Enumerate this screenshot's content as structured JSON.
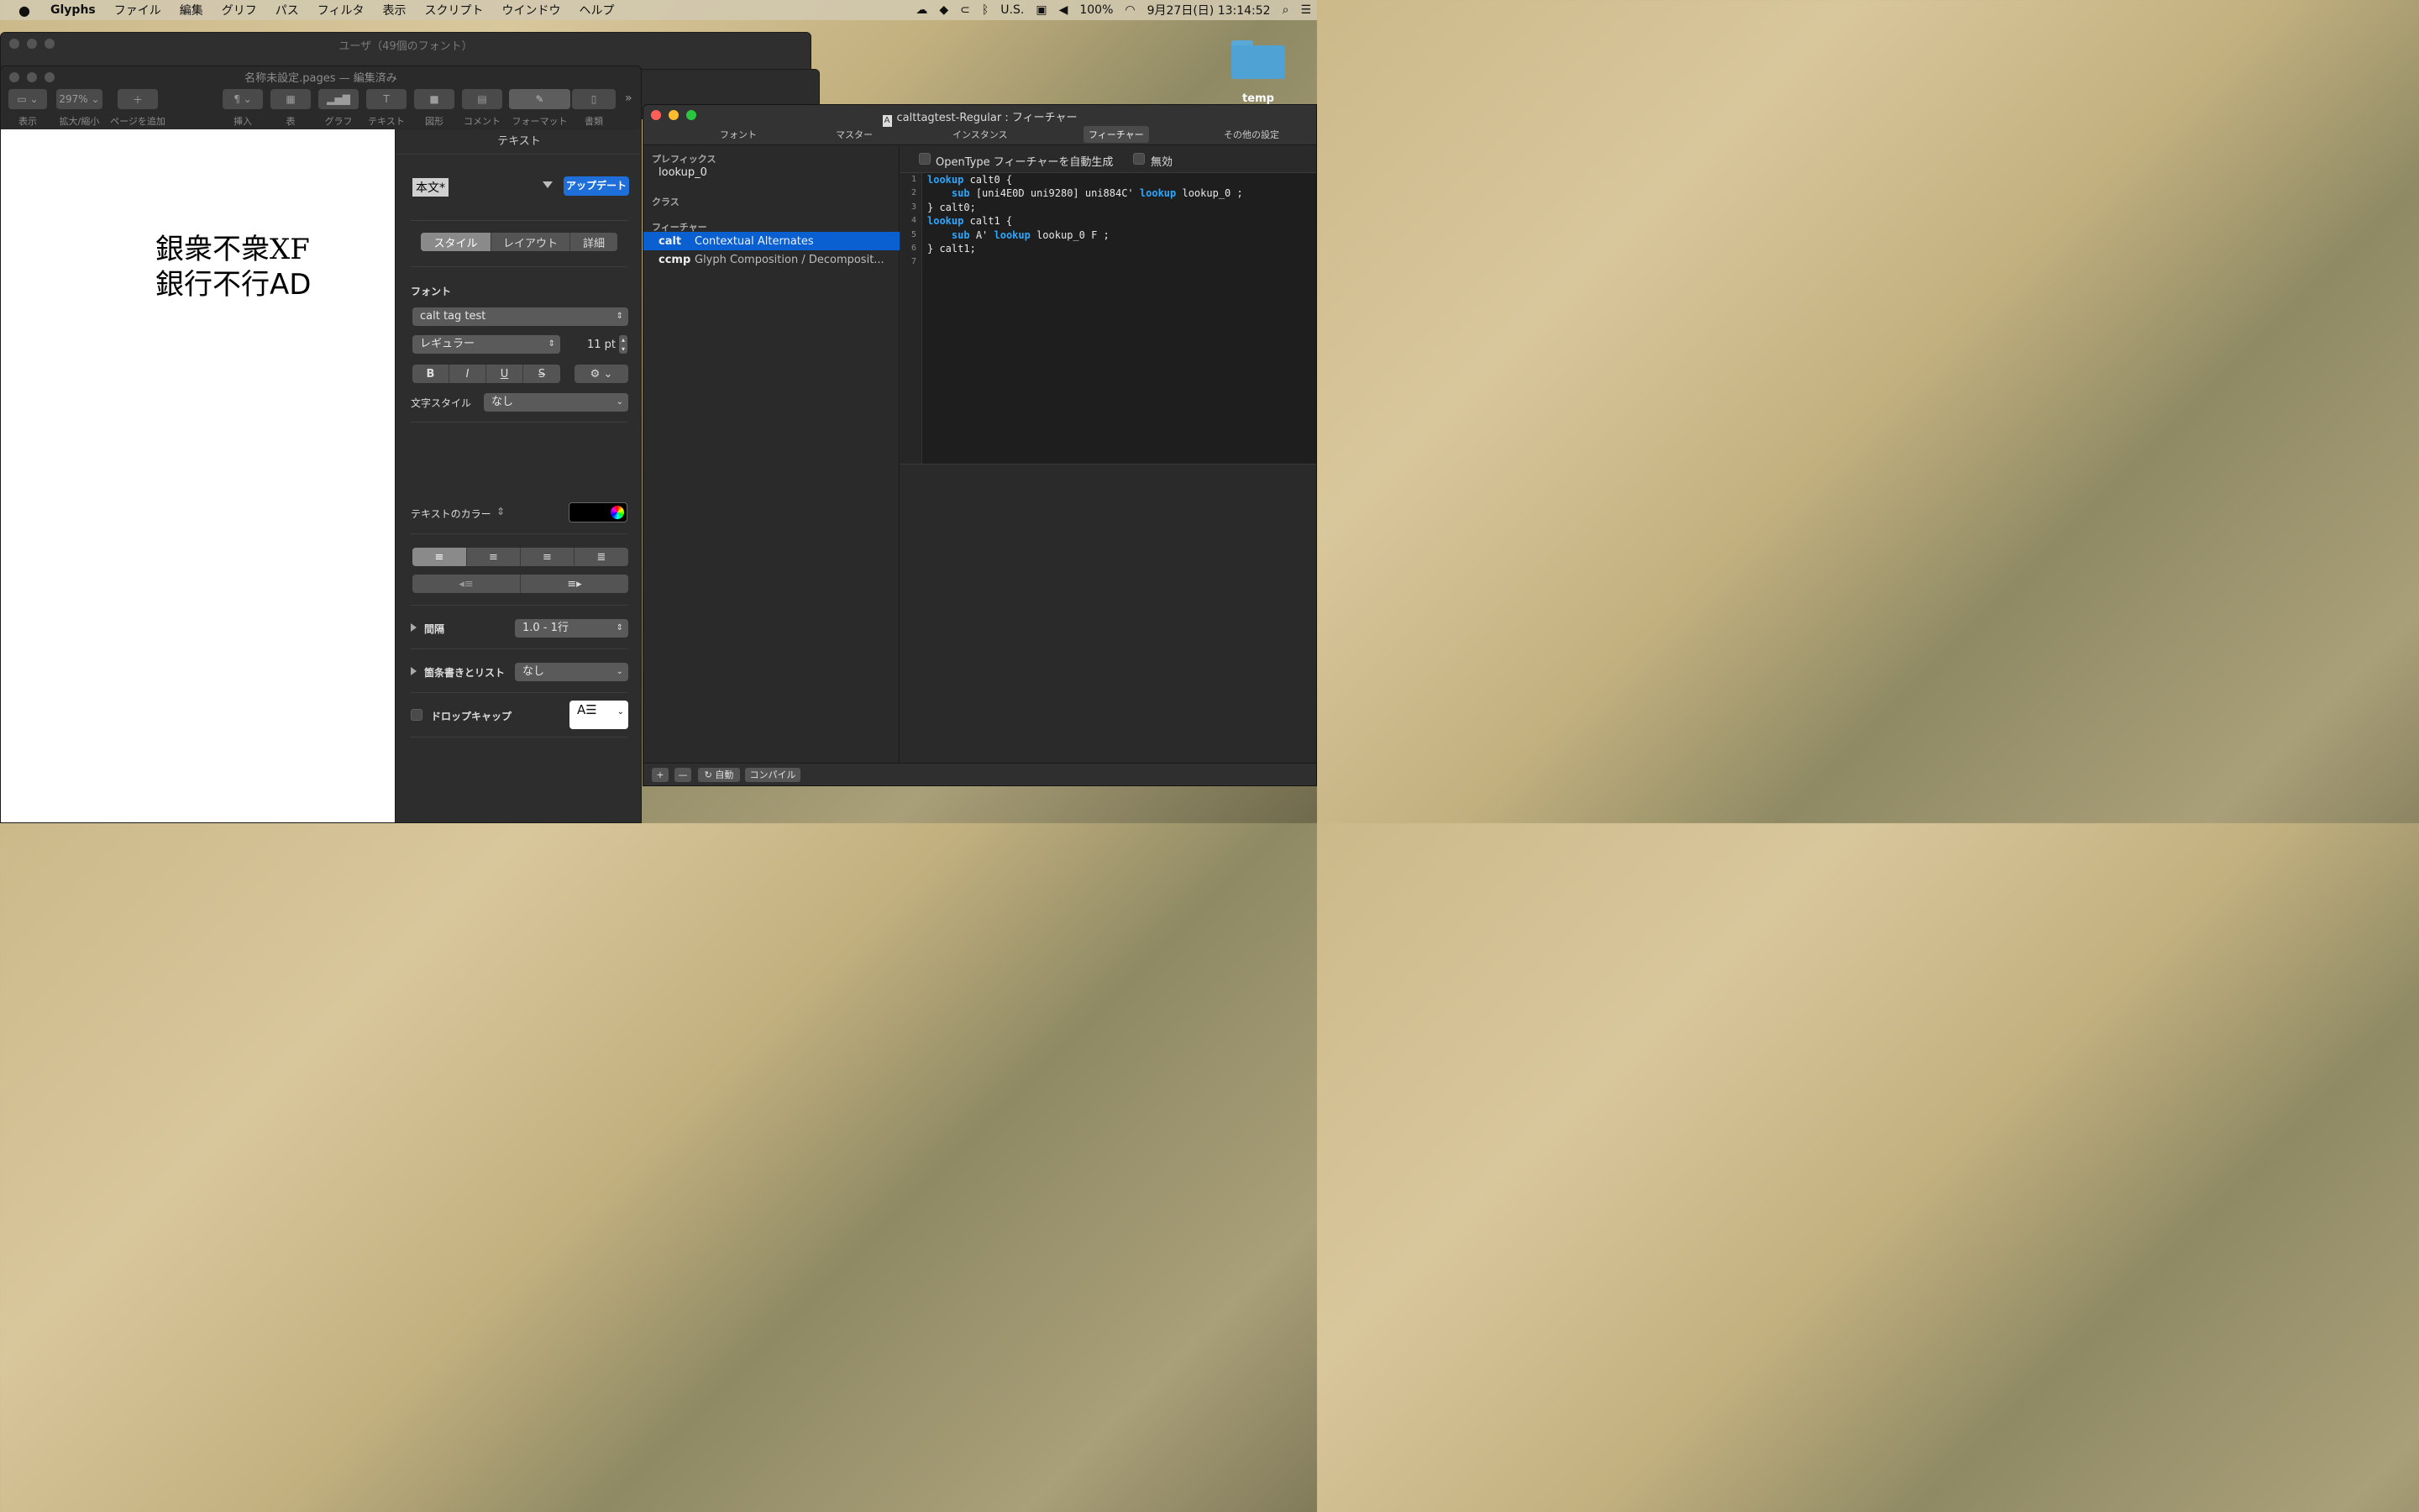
{
  "menubar": {
    "apple": "",
    "app": "Glyphs",
    "items": [
      "ファイル",
      "編集",
      "グリフ",
      "パス",
      "フィルタ",
      "表示",
      "スクリプト",
      "ウインドウ",
      "ヘルプ"
    ],
    "status": {
      "keyboard": "U.S.",
      "battery": "100%",
      "datetime": "9月27日(日)  13:14:52"
    }
  },
  "desktop": {
    "folder_label": "temp"
  },
  "back_window": {
    "title": "ユーザ（49個のフォント）"
  },
  "pages": {
    "title": "名称未設定.pages — 編集済み",
    "toolbar": {
      "view_label": "表示",
      "zoom_value": "297%",
      "zoom_label": "拡大/縮小",
      "add_page_label": "ページを追加",
      "insert_label": "挿入",
      "table_label": "表",
      "chart_label": "グラフ",
      "text_label": "テキスト",
      "shape_label": "図形",
      "comment_label": "コメント",
      "format_label": "フォーマット",
      "document_label": "書類"
    },
    "document": {
      "line1": "銀衆不衆XF",
      "line2": "銀行不行AD"
    },
    "inspector": {
      "header": "テキスト",
      "paragraph_style": "本文*",
      "update_button": "アップデート",
      "tabs": [
        "スタイル",
        "レイアウト",
        "詳細"
      ],
      "font_section": "フォント",
      "font_name": "calt tag test",
      "font_style": "レギュラー",
      "font_size": "11 pt",
      "bold": "B",
      "italic": "I",
      "underline": "U",
      "strike": "S",
      "char_style_label": "文字スタイル",
      "char_style_value": "なし",
      "text_color_label": "テキストのカラー",
      "text_color": "#000000",
      "spacing_label": "間隔",
      "spacing_value": "1.0 - 1行",
      "bullets_label": "箇条書きとリスト",
      "bullets_value": "なし",
      "dropcap_label": "ドロップキャップ"
    }
  },
  "glyphs": {
    "title": "calttagtest-Regular : フィーチャー",
    "tabs": [
      "フォント",
      "マスター",
      "インスタンス",
      "フィーチャー",
      "その他の設定"
    ],
    "sidebar": {
      "prefix_head": "プレフィックス",
      "prefix_item": "lookup_0",
      "class_head": "クラス",
      "feature_head": "フィーチャー",
      "features": [
        {
          "tag": "calt",
          "desc": "Contextual Alternates"
        },
        {
          "tag": "ccmp",
          "desc": "Glyph Composition / Decomposit..."
        }
      ]
    },
    "options": {
      "auto_generate": "OpenType フィーチャーを自動生成",
      "disabled": "無効"
    },
    "code_lines": [
      "1",
      "2",
      "3",
      "4",
      "5",
      "6",
      "7"
    ],
    "bottom": {
      "add": "+",
      "remove": "—",
      "auto": "自動",
      "compile": "コンパイル"
    },
    "colors": {
      "selection": "#0a5fd1",
      "keyword": "#2aa7ff"
    }
  }
}
